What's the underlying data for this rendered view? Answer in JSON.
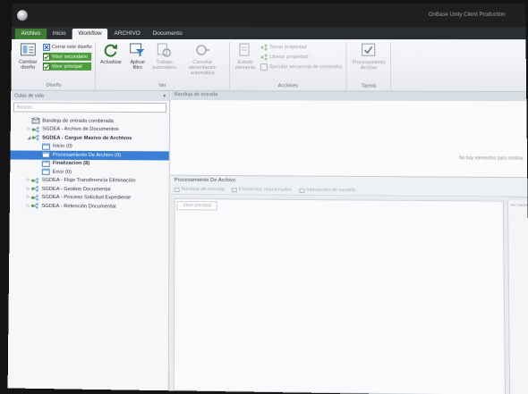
{
  "window": {
    "title": "OnBase Unity Client Production"
  },
  "tabs": [
    {
      "label": "Archivo",
      "kind": "file"
    },
    {
      "label": "Inicio",
      "kind": "normal"
    },
    {
      "label": "Workflow",
      "kind": "active"
    },
    {
      "label": "ARCHIVO",
      "kind": "normal"
    },
    {
      "label": "Documento",
      "kind": "normal"
    }
  ],
  "ribbon": {
    "design": {
      "label": "Diseño",
      "change_design": "Cambiar diseño",
      "close_design": "Cerrar este diseño",
      "view_secondary": "Visor secundario",
      "view_main": "Visor principal"
    },
    "view": {
      "label": "Ver",
      "refresh": "Actualizar",
      "apply_filter": "Aplicar filtro",
      "auto_work": "Trabajo automático",
      "cancel_auto_feed": "Cancelar alimentación automática"
    },
    "actions": {
      "label": "Acciones",
      "element_state": "Estado elemento",
      "take_ownership": "Tomar propiedad",
      "release_ownership": "Liberar propiedad",
      "run_connection": "Ejecutar secuencia de comandos"
    },
    "tasks": {
      "label": "Tareas",
      "process_files": "Procesamiento Archivo"
    }
  },
  "left_pane": {
    "header": "Colas de vida",
    "search_placeholder": "Buscar...",
    "tree": [
      {
        "label": "Bandeja de entrada combinada",
        "level": 0,
        "icon": "combined-inbox",
        "bold": false,
        "selected": false,
        "expander": ""
      },
      {
        "label": "SGDEA - Archivo de Documentos",
        "level": 0,
        "icon": "workflow",
        "bold": false,
        "selected": false,
        "expander": "▷"
      },
      {
        "label": "SGDEA - Cargue Masivo de Archivos",
        "level": 0,
        "icon": "workflow",
        "bold": true,
        "selected": false,
        "expander": "◢"
      },
      {
        "label": "Inicio (0)",
        "level": 1,
        "icon": "queue",
        "bold": false,
        "selected": false,
        "expander": ""
      },
      {
        "label": "Procesamiento De Archivo (0)",
        "level": 1,
        "icon": "queue",
        "bold": false,
        "selected": true,
        "expander": ""
      },
      {
        "label": "Finalizacion (8)",
        "level": 1,
        "icon": "queue",
        "bold": true,
        "selected": false,
        "expander": ""
      },
      {
        "label": "Error (0)",
        "level": 1,
        "icon": "queue",
        "bold": false,
        "selected": false,
        "expander": ""
      },
      {
        "label": "SGDEA - Flujo Transferencia Eliminación",
        "level": 0,
        "icon": "workflow",
        "bold": false,
        "selected": false,
        "expander": "▷"
      },
      {
        "label": "SGDEA - Gestion Documental",
        "level": 0,
        "icon": "workflow",
        "bold": false,
        "selected": false,
        "expander": "▷"
      },
      {
        "label": "SGDEA - Proceso Solicitud Expediente",
        "level": 0,
        "icon": "workflow",
        "bold": false,
        "selected": false,
        "expander": "▷"
      },
      {
        "label": "SGDEA - Retención Documental",
        "level": 0,
        "icon": "workflow",
        "bold": false,
        "selected": false,
        "expander": "▷"
      }
    ]
  },
  "right_pane": {
    "inbox_header": "Bandeja de entrada",
    "empty_message": "No hay elementos para mostrar",
    "lower_title": "Procesamiento De Archivo",
    "lower_toolbar": [
      "Bandeja de entrada",
      "Elementos relacionados",
      "Interacción de usuario"
    ],
    "view_tab": "Visor principal",
    "side_label": "Ver carpeta"
  }
}
